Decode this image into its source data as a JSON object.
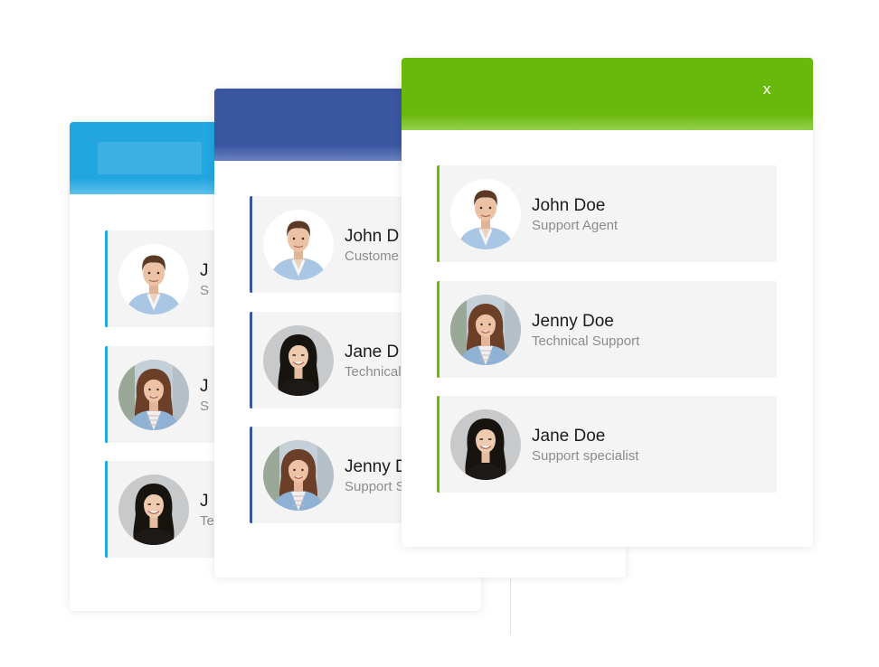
{
  "colors": {
    "blue": "#22a6e0",
    "navy": "#3a56a1",
    "green": "#69b80c"
  },
  "front_card": {
    "close_label": "x",
    "agents": [
      {
        "name": "John Doe",
        "role": "Support Agent",
        "avatar": "male-agent-avatar"
      },
      {
        "name": "Jenny Doe",
        "role": "Technical Support",
        "avatar": "female-agent-long-hair-avatar"
      },
      {
        "name": "Jane Doe",
        "role": "Support specialist",
        "avatar": "female-agent-dark-hair-avatar"
      }
    ]
  },
  "middle_card": {
    "agents": [
      {
        "name": "John D",
        "role": "Custome",
        "avatar": "male-agent-avatar"
      },
      {
        "name": "Jane D",
        "role": "Technical",
        "avatar": "female-agent-dark-hair-avatar"
      },
      {
        "name": "Jenny D",
        "role": "Support S",
        "avatar": "female-agent-long-hair-avatar"
      }
    ]
  },
  "back_card": {
    "agents": [
      {
        "name": "J",
        "role": "S",
        "avatar": "male-agent-avatar"
      },
      {
        "name": "J",
        "role": "S",
        "avatar": "female-agent-long-hair-avatar"
      },
      {
        "name": "J",
        "role": "Te",
        "avatar": "female-agent-dark-hair-avatar"
      }
    ]
  }
}
